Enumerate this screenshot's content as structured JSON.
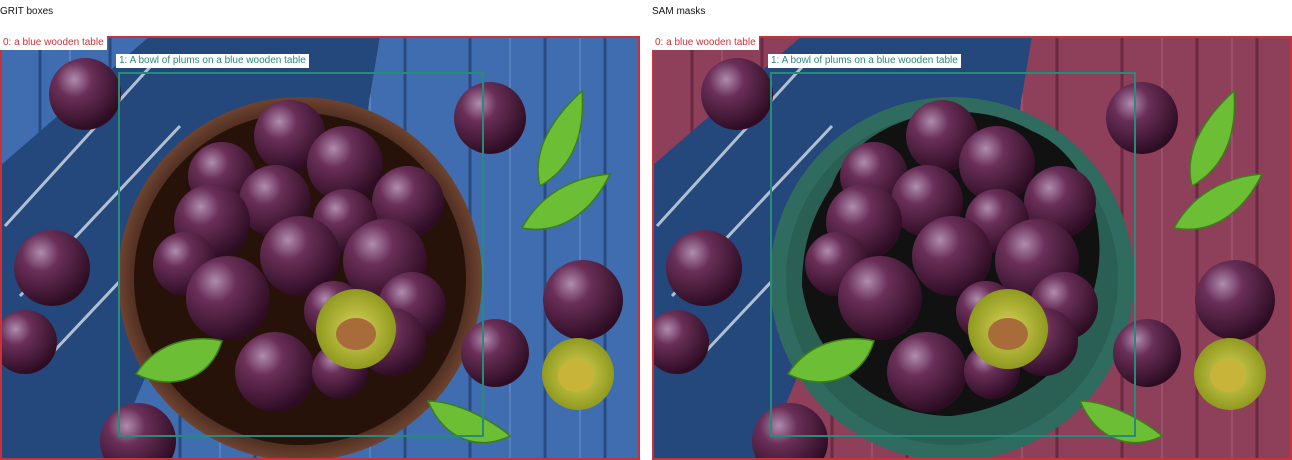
{
  "panels": [
    {
      "title": "GRIT boxes",
      "boxes": [
        {
          "label": "0: a blue wooden table",
          "color": "#c9323a"
        },
        {
          "label": "1: A bowl of plums on a blue wooden table",
          "color": "#2a8a7a"
        }
      ]
    },
    {
      "title": "SAM masks",
      "boxes": [
        {
          "label": "0: a blue wooden table",
          "color": "#c9323a"
        },
        {
          "label": "1: A bowl of plums on a blue wooden table",
          "color": "#2a8a7a"
        }
      ],
      "mask_colors": {
        "table": "#8e3f5a",
        "bowl": "#2f6b5e"
      }
    }
  ]
}
